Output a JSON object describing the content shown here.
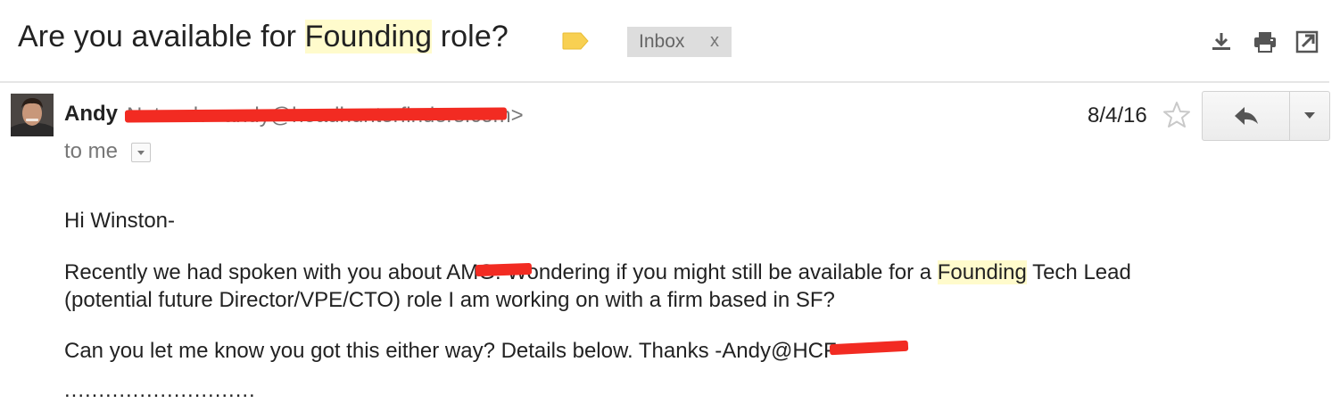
{
  "subject": {
    "before": "Are you available for ",
    "highlight": "Founding",
    "after": " role?"
  },
  "labels": {
    "inbox": "Inbox",
    "remove": "x"
  },
  "toolbar": {
    "icons": [
      "download-icon",
      "print-icon",
      "new-window-icon"
    ]
  },
  "message": {
    "sender_name": "Andy",
    "sender_email_partial": "Nutsuch  <andy@headhunterfinders.com>",
    "recipient": "to me",
    "date": "8/4/16"
  },
  "body": {
    "greeting": "Hi  Winston-",
    "p1_a": "Recently we had spoken with you about ",
    "p1_redacted": "AMG",
    "p1_b": ". Wondering if you might still be available for a ",
    "p1_highlight": "Founding",
    "p1_c": " Tech Lead",
    "p1_line2": "(potential future Director/VPE/CTO) role I am working on with a firm based in SF?",
    "p2_a": "Can you let me know you got this either way?  Details below. Thanks -Andy",
    "p2_redacted": "@HCF",
    "dots": "............................"
  },
  "colors": {
    "highlight": "#fffbcc",
    "redaction": "#f22b22",
    "label_tag": "#f8d052",
    "inbox_chip": "#dddddd"
  }
}
